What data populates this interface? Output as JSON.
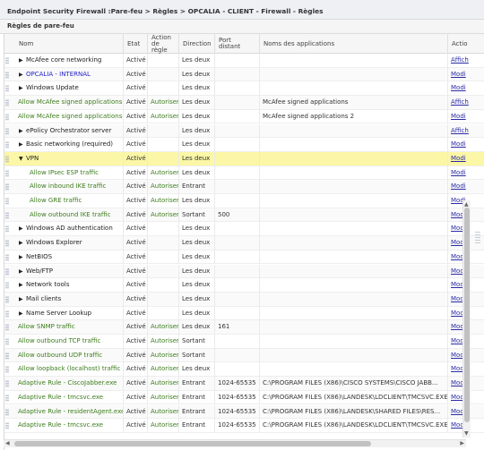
{
  "breadcrumb": "Endpoint Security Firewall :Pare-feu > Règles > OPCALIA - CLIENT - Firewall - Règles",
  "section_title": "Règles de pare-feu",
  "columns": {
    "name": "Nom",
    "state": "Etat",
    "action": "Action de règle",
    "direction": "Direction",
    "remote_port": "Port distant",
    "apps": "Noms des applications",
    "actions": "Actio"
  },
  "rows": [
    {
      "expander": "▶",
      "name": "McAfee core networking",
      "color": "black",
      "state": "Activé",
      "action": "",
      "direction": "Les deux",
      "port": "",
      "apps": "",
      "link": "Affich"
    },
    {
      "expander": "▶",
      "name": "OPCALIA - INTERNAL",
      "color": "blue",
      "state": "Activé",
      "action": "",
      "direction": "Les deux",
      "port": "",
      "apps": "",
      "link": "Modi"
    },
    {
      "expander": "▶",
      "name": "Windows Update",
      "color": "black",
      "state": "Activé",
      "action": "",
      "direction": "Les deux",
      "port": "",
      "apps": "",
      "link": "Modi"
    },
    {
      "expander": "",
      "name": "Allow McAfee signed applications",
      "color": "green",
      "state": "Activé",
      "action": "Autoriser",
      "direction": "Les deux",
      "port": "",
      "apps": "McAfee signed applications",
      "link": "Affich"
    },
    {
      "expander": "",
      "name": "Allow McAfee signed applications 2",
      "color": "green",
      "state": "Activé",
      "action": "Autoriser",
      "direction": "Les deux",
      "port": "",
      "apps": "McAfee signed applications 2",
      "link": "Modi"
    },
    {
      "expander": "▶",
      "name": "ePolicy Orchestrator server",
      "color": "black",
      "state": "Activé",
      "action": "",
      "direction": "Les deux",
      "port": "",
      "apps": "",
      "link": "Affich"
    },
    {
      "expander": "▶",
      "name": "Basic networking (required)",
      "color": "black",
      "state": "Activé",
      "action": "",
      "direction": "Les deux",
      "port": "",
      "apps": "",
      "link": "Modi"
    },
    {
      "expander": "▼",
      "name": "VPN",
      "color": "black",
      "state": "Activé",
      "action": "",
      "direction": "Les deux",
      "port": "",
      "apps": "",
      "link": "Modi",
      "selected": true
    },
    {
      "expander": "",
      "indent": true,
      "name": "Allow IPsec ESP traffic",
      "color": "green",
      "state": "Activé",
      "action": "Autoriser",
      "direction": "Les deux",
      "port": "",
      "apps": "",
      "link": "Modi"
    },
    {
      "expander": "",
      "indent": true,
      "name": "Allow inbound IKE traffic",
      "color": "green",
      "state": "Activé",
      "action": "Autoriser",
      "direction": "Entrant",
      "port": "",
      "apps": "",
      "link": "Modi"
    },
    {
      "expander": "",
      "indent": true,
      "name": "Allow GRE traffic",
      "color": "green",
      "state": "Activé",
      "action": "Autoriser",
      "direction": "Les deux",
      "port": "",
      "apps": "",
      "link": "Modi"
    },
    {
      "expander": "",
      "indent": true,
      "name": "Allow outbound IKE traffic",
      "color": "green",
      "state": "Activé",
      "action": "Autoriser",
      "direction": "Sortant",
      "port": "500",
      "apps": "",
      "link": "Modi"
    },
    {
      "expander": "▶",
      "name": "Windows AD authentication",
      "color": "black",
      "state": "Activé",
      "action": "",
      "direction": "Les deux",
      "port": "",
      "apps": "",
      "link": "Modi"
    },
    {
      "expander": "▶",
      "name": "Windows Explorer",
      "color": "black",
      "state": "Activé",
      "action": "",
      "direction": "Les deux",
      "port": "",
      "apps": "",
      "link": "Modi"
    },
    {
      "expander": "▶",
      "name": "NetBIOS",
      "color": "black",
      "state": "Activé",
      "action": "",
      "direction": "Les deux",
      "port": "",
      "apps": "",
      "link": "Modi"
    },
    {
      "expander": "▶",
      "name": "Web/FTP",
      "color": "black",
      "state": "Activé",
      "action": "",
      "direction": "Les deux",
      "port": "",
      "apps": "",
      "link": "Modi"
    },
    {
      "expander": "▶",
      "name": "Network tools",
      "color": "black",
      "state": "Activé",
      "action": "",
      "direction": "Les deux",
      "port": "",
      "apps": "",
      "link": "Modi"
    },
    {
      "expander": "▶",
      "name": "Mail clients",
      "color": "black",
      "state": "Activé",
      "action": "",
      "direction": "Les deux",
      "port": "",
      "apps": "",
      "link": "Modi"
    },
    {
      "expander": "▶",
      "name": "Name Server Lookup",
      "color": "black",
      "state": "Activé",
      "action": "",
      "direction": "Les deux",
      "port": "",
      "apps": "",
      "link": "Modi"
    },
    {
      "expander": "",
      "name": "Allow SNMP traffic",
      "color": "green",
      "state": "Activé",
      "action": "Autoriser",
      "direction": "Les deux",
      "port": "161",
      "apps": "",
      "link": "Modi"
    },
    {
      "expander": "",
      "name": "Allow outbound TCP traffic",
      "color": "green",
      "state": "Activé",
      "action": "Autoriser",
      "direction": "Sortant",
      "port": "",
      "apps": "",
      "link": "Modi"
    },
    {
      "expander": "",
      "name": "Allow outbound UDP traffic",
      "color": "green",
      "state": "Activé",
      "action": "Autoriser",
      "direction": "Sortant",
      "port": "",
      "apps": "",
      "link": "Modi"
    },
    {
      "expander": "",
      "name": "Allow loopback (localhost) traffic",
      "color": "green",
      "state": "Activé",
      "action": "Autoriser",
      "direction": "Les deux",
      "port": "",
      "apps": "",
      "link": "Modi"
    },
    {
      "expander": "",
      "name": "Adaptive Rule - CiscoJabber.exe",
      "color": "green",
      "state": "Activé",
      "action": "Autoriser",
      "direction": "Entrant",
      "port": "1024-65535",
      "apps": "C:\\PROGRAM FILES (X86)\\CISCO SYSTEMS\\CISCO JABB...",
      "link": "Modi"
    },
    {
      "expander": "",
      "name": "Adaptive Rule - tmcsvc.exe",
      "color": "green",
      "state": "Activé",
      "action": "Autoriser",
      "direction": "Entrant",
      "port": "1024-65535",
      "apps": "C:\\PROGRAM FILES (X86)\\LANDESK\\LDCLIENT\\TMCSVC.EXE",
      "link": "Modi"
    },
    {
      "expander": "",
      "name": "Adaptive Rule - residentAgent.exe",
      "color": "green",
      "state": "Activé",
      "action": "Autoriser",
      "direction": "Entrant",
      "port": "1024-65535",
      "apps": "C:\\PROGRAM FILES (X86)\\LANDESK\\SHARED FILES\\RES...",
      "link": "Modi"
    },
    {
      "expander": "",
      "name": "Adaptive Rule - tmcsvc.exe",
      "color": "green",
      "state": "Activé",
      "action": "Autoriser",
      "direction": "Entrant",
      "port": "1024-65535",
      "apps": "C:\\PROGRAM FILES (X86)\\LANDESK\\LDCLIENT\\TMCSVC.EXE",
      "link": "Modi"
    }
  ],
  "scrollbar": {
    "up": "▲",
    "down": "▼",
    "left": "◀",
    "right": "▶"
  }
}
